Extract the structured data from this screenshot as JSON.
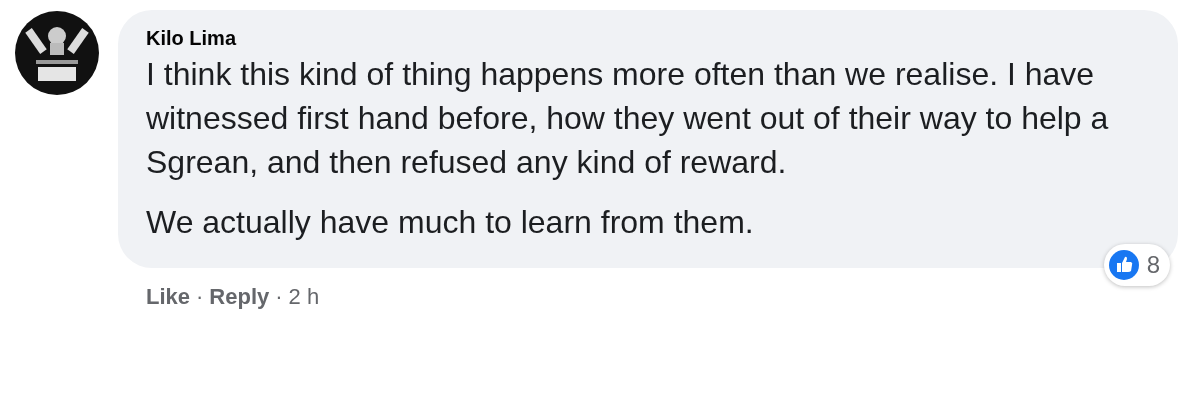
{
  "comment": {
    "author": "Kilo Lima",
    "paragraphs": [
      "I think this kind of thing happens more often than we realise. I have witnessed first hand before, how they went out of their way to help a Sgrean, and then refused any kind of reward.",
      "We actually have much to learn from them."
    ],
    "reactions": {
      "count": "8"
    }
  },
  "actions": [
    {
      "label": "Like",
      "kind": "link"
    },
    {
      "label": "·",
      "kind": "separator"
    },
    {
      "label": "Reply",
      "kind": "link"
    },
    {
      "label": "·",
      "kind": "separator"
    },
    {
      "label": "2 h",
      "kind": "time"
    }
  ]
}
